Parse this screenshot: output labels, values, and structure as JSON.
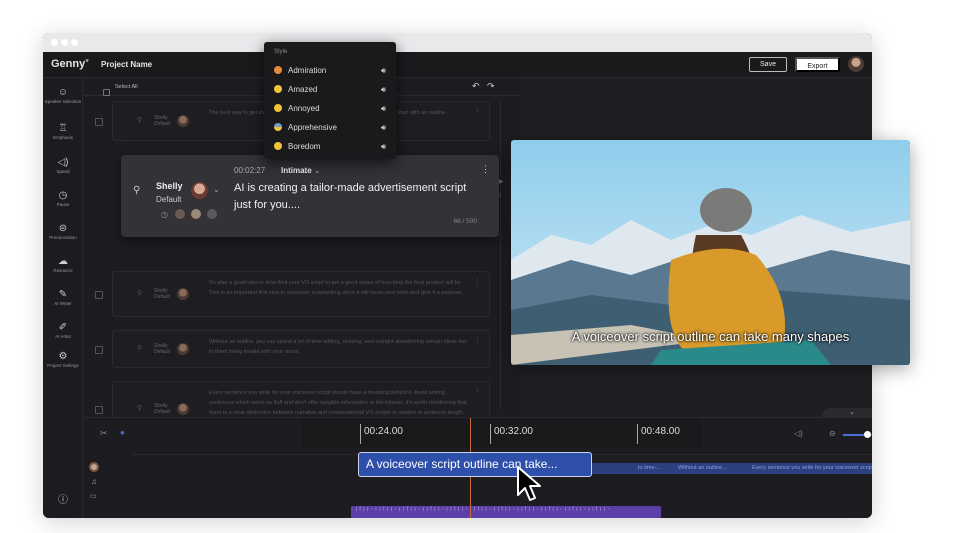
{
  "app": {
    "logo": "Genny",
    "project_name": "Project Name",
    "save_label": "Save",
    "export_label": "Export"
  },
  "sidebar": {
    "items": [
      {
        "icon": "speaker-selection-icon",
        "label": "Speaker Selection"
      },
      {
        "icon": "emphasis-icon",
        "label": "Emphasis"
      },
      {
        "icon": "speed-icon",
        "label": "Speed"
      },
      {
        "icon": "pause-icon",
        "label": "Pause"
      },
      {
        "icon": "pronunciation-icon",
        "label": "Pronunciation"
      },
      {
        "icon": "resource-icon",
        "label": "Resource"
      },
      {
        "icon": "ai-writer-icon",
        "label": "AI Writer"
      },
      {
        "icon": "ai-artist-icon",
        "label": "AI Artist"
      },
      {
        "icon": "project-settings-icon",
        "label": "Project Settings"
      }
    ]
  },
  "toolbar": {
    "select_all": "Select All"
  },
  "style_menu": {
    "title": "Style",
    "items": [
      {
        "label": "Admiration",
        "color": "#e8873a"
      },
      {
        "label": "Amazed",
        "color": "#f2c23a"
      },
      {
        "label": "Annoyed",
        "color": "#f2c23a"
      },
      {
        "label": "Apprehensive",
        "color": "#7a9ac8"
      },
      {
        "label": "Boredom",
        "color": "#f2c23a"
      }
    ]
  },
  "rows": [
    {
      "speaker": "Shelly",
      "voice": "Default",
      "text": "The best way to get started on your voiceover script... it a good direction is to start with an outline."
    },
    {
      "speaker": "Shelly",
      "voice": "Default",
      "text": "It's also a good idea to time-limit your VO script to get a good sense of how long the final product will be. This is an important first step in voiceover scriptwriting since it will focus your work and give it a purpose."
    },
    {
      "speaker": "Shelly",
      "voice": "Default",
      "text": "Without an outline, you can spend a lot of time editing, revising, and outright abandoning certain ideas due to them being invalid with your vision."
    },
    {
      "speaker": "Shelly",
      "voice": "Default",
      "text": "Every sentence you write for your voiceover script should have a meaning behind it. Avoid writing sentences which serve as fluff and don't offer tangible information to the listener. It's worth mentioning that there is a clear distinction between narrative and conversational VO scripts in relation to sentence length."
    }
  ],
  "active_row": {
    "speaker": "Shelly",
    "voice": "Default",
    "time": "00:02:27",
    "style": "Intimate",
    "text": "AI is creating a tailor-made advertisement script just for you....",
    "count": "66 / 500"
  },
  "video": {
    "caption": "A voiceover script outline can take many shapes"
  },
  "timeline": {
    "timecodes": [
      "00:24.00",
      "00:32.00",
      "00:48.00"
    ],
    "selected_clip": "A voiceover script outline can take...",
    "other_clips": [
      "to time-...",
      "Without an outline...",
      "Every sentence you write for your voiceover script"
    ],
    "zoom_level": 0.6
  }
}
